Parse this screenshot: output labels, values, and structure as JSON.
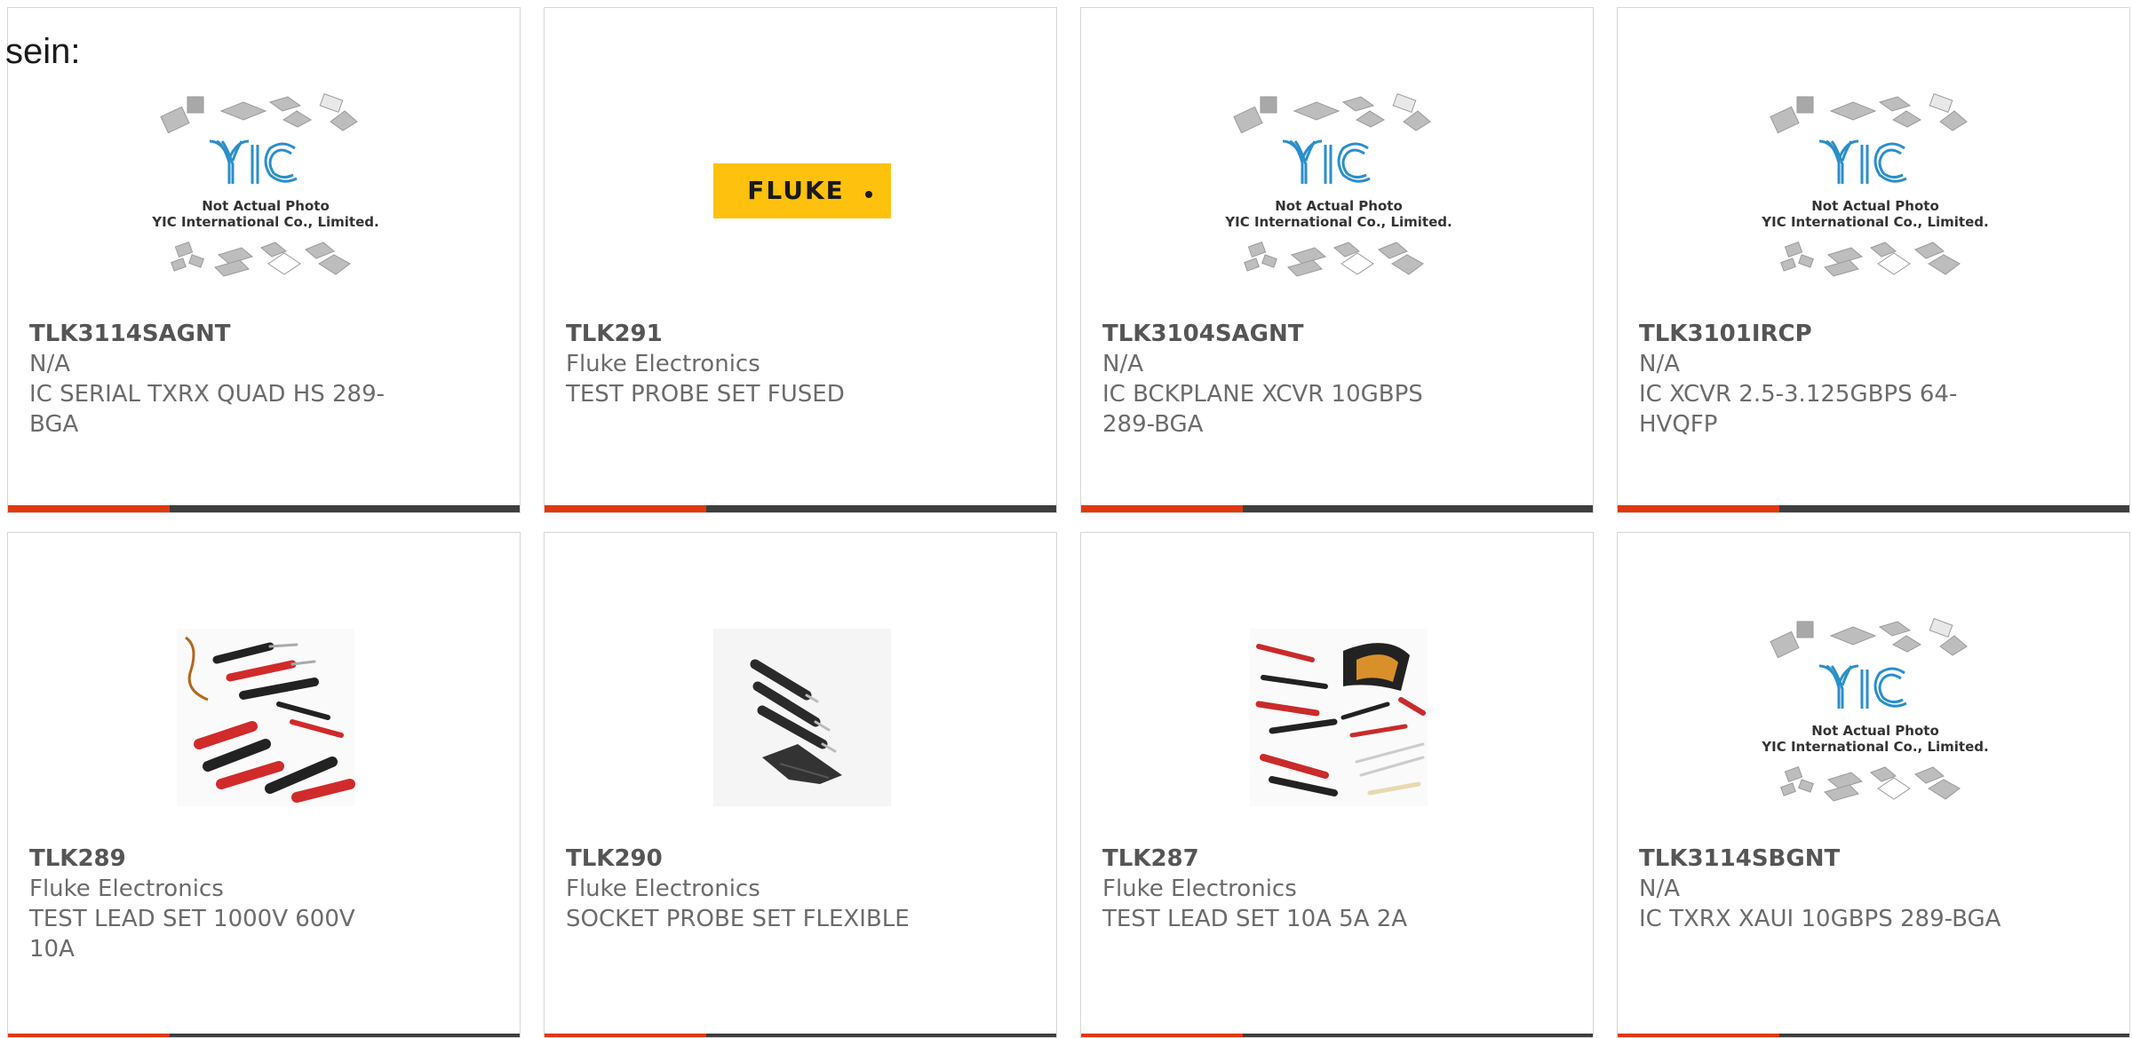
{
  "heading": "sein:",
  "colors": {
    "accent": "#e0380e",
    "bar": "#3e3e3e",
    "border": "#d6d6d6",
    "text": "#6b6b6b"
  },
  "placeholder": {
    "line1": "Not Actual Photo",
    "line2": "YIC International Co., Limited.",
    "logo": "YIC"
  },
  "fluke_logo": "FLUKE",
  "products": [
    {
      "part": "TLK3114SAGNT",
      "maker": "N/A",
      "desc": "IC SERIAL TXRX QUAD HS 289-BGA",
      "image": "yic-placeholder"
    },
    {
      "part": "TLK291",
      "maker": "Fluke Electronics",
      "desc": "TEST PROBE SET FUSED",
      "image": "fluke-logo"
    },
    {
      "part": "TLK3104SAGNT",
      "maker": "N/A",
      "desc": "IC BCKPLANE XCVR 10GBPS 289-BGA",
      "image": "yic-placeholder"
    },
    {
      "part": "TLK3101IRCP",
      "maker": "N/A",
      "desc": "IC XCVR 2.5-3.125GBPS 64-HVQFP",
      "image": "yic-placeholder"
    },
    {
      "part": "TLK289",
      "maker": "Fluke Electronics",
      "desc": "TEST LEAD SET 1000V 600V 10A",
      "image": "test-leads-photo"
    },
    {
      "part": "TLK290",
      "maker": "Fluke Electronics",
      "desc": "SOCKET PROBE SET FLEXIBLE",
      "image": "socket-probes-photo"
    },
    {
      "part": "TLK287",
      "maker": "Fluke Electronics",
      "desc": "TEST LEAD SET 10A 5A 2A",
      "image": "lead-kit-photo"
    },
    {
      "part": "TLK3114SBGNT",
      "maker": "N/A",
      "desc": "IC TXRX XAUI 10GBPS 289-BGA",
      "image": "yic-placeholder"
    }
  ]
}
